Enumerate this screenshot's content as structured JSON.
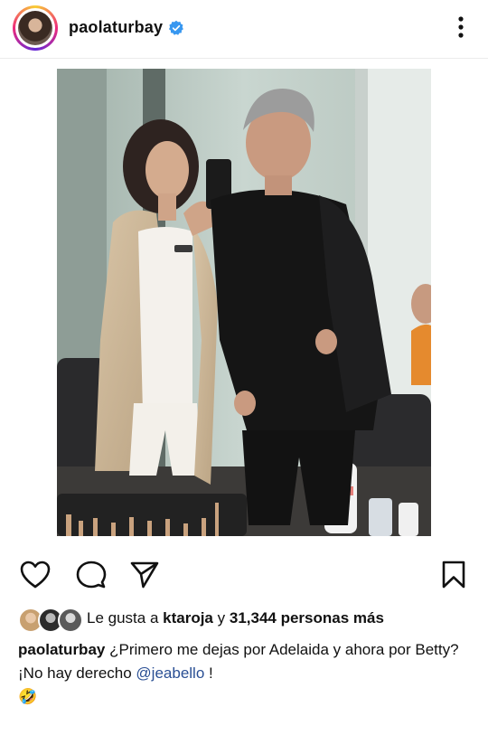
{
  "post": {
    "username": "paolaturbay",
    "verified": true
  },
  "likes": {
    "prefix": "Le gusta a",
    "liker": "ktaroja",
    "connector": "y",
    "count_text": "31,344 personas más"
  },
  "caption": {
    "username": "paolaturbay",
    "line1": "¿Primero me dejas por Adelaida y ahora por Betty?",
    "line2_prefix": "¡No hay derecho",
    "mention": "@jeabello",
    "line2_suffix": " !",
    "emoji": "🤣"
  },
  "icons": {
    "verified": "verified-badge-icon",
    "more": "more-options-icon",
    "like": "heart-icon",
    "comment": "comment-icon",
    "share": "send-icon",
    "save": "bookmark-icon"
  },
  "colors": {
    "verified_blue": "#3797f0",
    "mention_blue": "#2a4f94"
  }
}
